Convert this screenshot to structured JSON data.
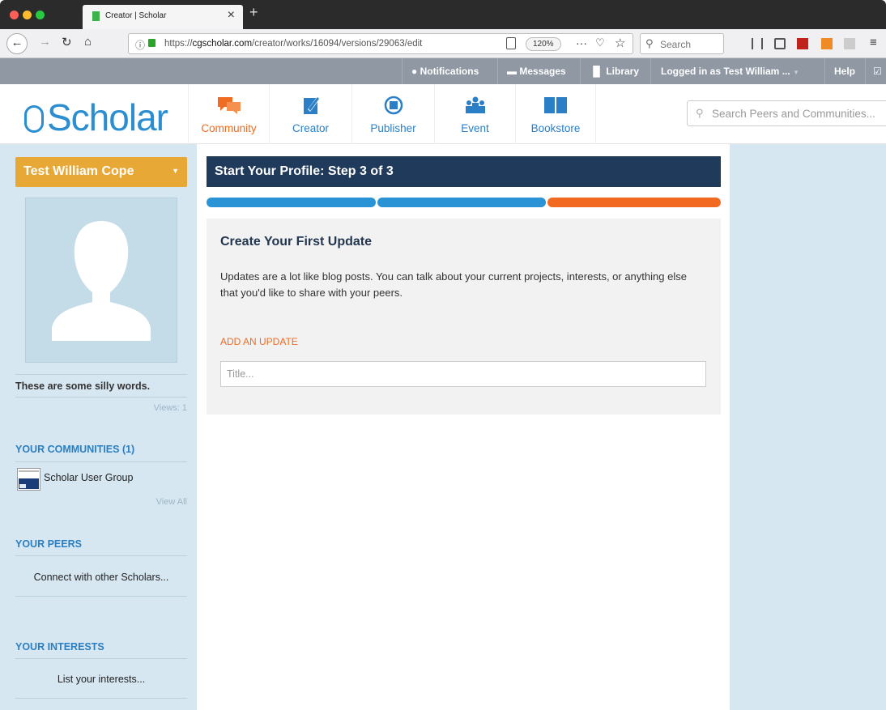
{
  "browser": {
    "tab_title": "Creator | Scholar",
    "tab_close": "×",
    "new_tab": "+",
    "url_prefix": "https://",
    "url_domain": "cgscholar.com",
    "url_path": "/creator/works/16094/versions/29063/edit",
    "zoom": "120%",
    "search_placeholder": "Search"
  },
  "topbar": {
    "notifications": "Notifications",
    "messages": "Messages",
    "library": "Library",
    "logged_in": "Logged in as Test William ...",
    "help": "Help"
  },
  "header": {
    "logo": "Scholar",
    "menu": [
      {
        "label": "Community",
        "icon": "community-icon",
        "color": "#ef6c22"
      },
      {
        "label": "Creator",
        "icon": "creator-icon",
        "color": "#2a7fc6"
      },
      {
        "label": "Publisher",
        "icon": "publisher-icon",
        "color": "#2a7fc6"
      },
      {
        "label": "Event",
        "icon": "event-icon",
        "color": "#2a7fc6"
      },
      {
        "label": "Bookstore",
        "icon": "bookstore-icon",
        "color": "#2a7fc6"
      }
    ],
    "search_placeholder": "Search Peers and Communities..."
  },
  "sidebar": {
    "user_name": "Test William Cope",
    "bio": "These are some silly words.",
    "views": "Views: 1",
    "communities_title": "YOUR COMMUNITIES (1)",
    "community_name": "Scholar User Group",
    "view_all": "View All",
    "peers_title": "YOUR PEERS",
    "peers_link": "Connect with other Scholars...",
    "interests_title": "YOUR INTERESTS",
    "interests_link": "List your interests..."
  },
  "main": {
    "step_title": "Start Your Profile: Step 3 of 3",
    "progress_colors": [
      "#2a93d5",
      "#2a93d5",
      "#f26a22"
    ],
    "card_title": "Create Your First Update",
    "card_desc": "Updates are a lot like blog posts. You can talk about your current projects, interests, or anything else that you'd like to share with your peers.",
    "add_update": "ADD AN UPDATE",
    "title_placeholder": "Title..."
  },
  "colors": {
    "accent_blue": "#2a8ed0",
    "navy": "#1f3a5a",
    "orange": "#ef6c22",
    "user_gold": "#e8a835",
    "sidebar_bg": "#d7e7f1"
  }
}
